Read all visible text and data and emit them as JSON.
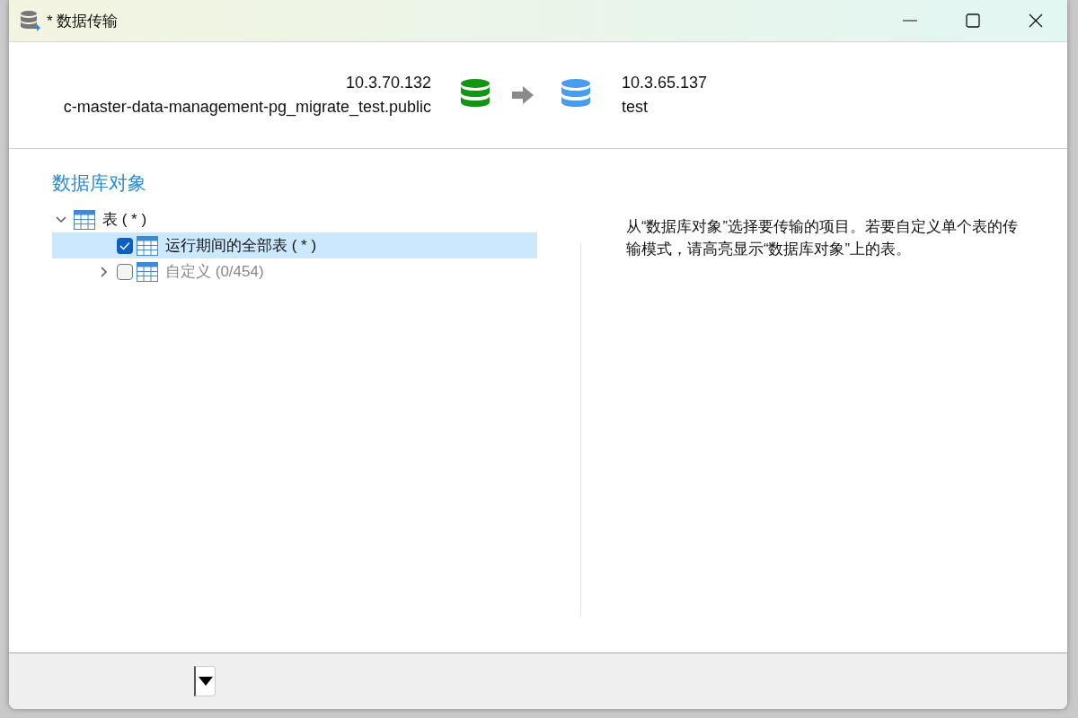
{
  "window": {
    "title": "* 数据传输"
  },
  "source": {
    "host": "10.3.70.132",
    "name": "c-master-data-management-pg_migrate_test.public"
  },
  "target": {
    "host": "10.3.65.137",
    "name": "test"
  },
  "section_title": "数据库对象",
  "tree": [
    {
      "label": "表 ( * )",
      "expanded": true,
      "children": [
        {
          "label": "运行期间的全部表 ( * )",
          "checked": true,
          "selected": true,
          "disabled": false
        },
        {
          "label": "自定义 (0/454)",
          "checked": false,
          "selected": false,
          "disabled": true,
          "expanded": false
        }
      ]
    }
  ],
  "help_text": "从“数据库对象”选择要传输的项目。若要自定义单个表的传输模式，请高亮显示“数据库对象”上的表。"
}
